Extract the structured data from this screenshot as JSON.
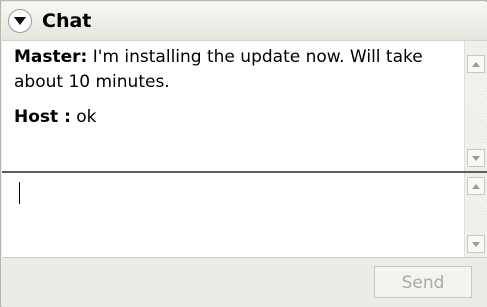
{
  "header": {
    "title": "Chat",
    "collapse_icon": "chevron-down-circle-icon"
  },
  "messages": [
    {
      "sender": "Master:",
      "text": "I'm installing the update now. Will take about 10 minutes."
    },
    {
      "sender": "Host :",
      "text": "ok"
    }
  ],
  "input": {
    "value": ""
  },
  "footer": {
    "send_label": "Send",
    "send_enabled": false
  },
  "colors": {
    "divider": "#5e5e5e",
    "disabled_text": "#a9a9a9"
  }
}
